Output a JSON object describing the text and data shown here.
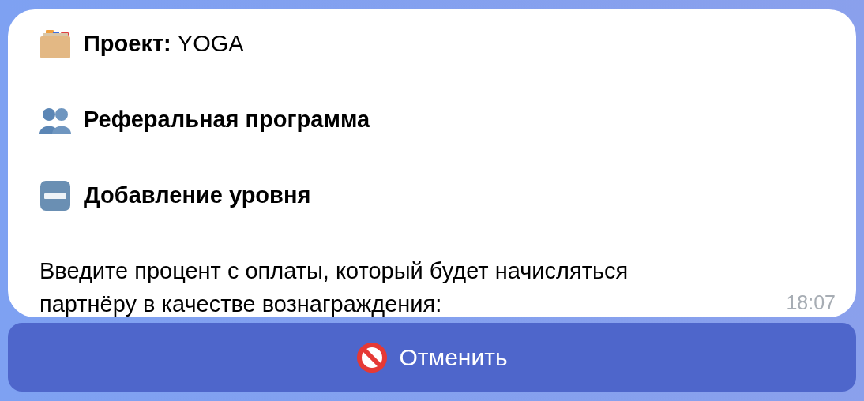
{
  "message": {
    "headings": [
      "**Проект:** YOGA",
      "Реферальная программа",
      "Добавление уровня"
    ],
    "text": "Введите процент с оплаты, который будет начисляться партнёру в качестве вознаграждения:",
    "time": "18:07"
  },
  "buttons": [
    {
      "label": "Отменить"
    }
  ]
}
